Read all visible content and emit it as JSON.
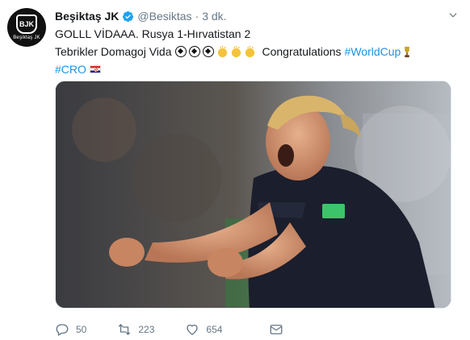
{
  "tweet": {
    "account": {
      "name": "Beşiktaş JK",
      "handle": "@Besiktas",
      "time": "3 dk.",
      "avatar_label": "Beşiktaş JK",
      "avatar_crest_text": "BJK"
    },
    "text": {
      "line1": "GOLLL VİDAAA. Rusya 1-Hırvatistan 2",
      "line2_prefix": "Tebrikler Domagoj Vida",
      "line2_suffix": "Congratulations",
      "hashtag_worldcup": "#WorldCup",
      "hashtag_cro": "#CRO"
    },
    "actions": {
      "replies": "50",
      "retweets": "223",
      "likes": "654"
    }
  },
  "colors": {
    "link": "#1b95e0",
    "muted": "#657786",
    "verified": "#1da1f2",
    "text": "#14171a"
  },
  "icons": [
    "verified-badge-icon",
    "caret-down-icon",
    "soccer-ball-icon",
    "clapping-hands-icon",
    "trophy-icon",
    "croatia-flag-icon",
    "reply-icon",
    "retweet-icon",
    "like-icon",
    "direct-message-icon"
  ]
}
